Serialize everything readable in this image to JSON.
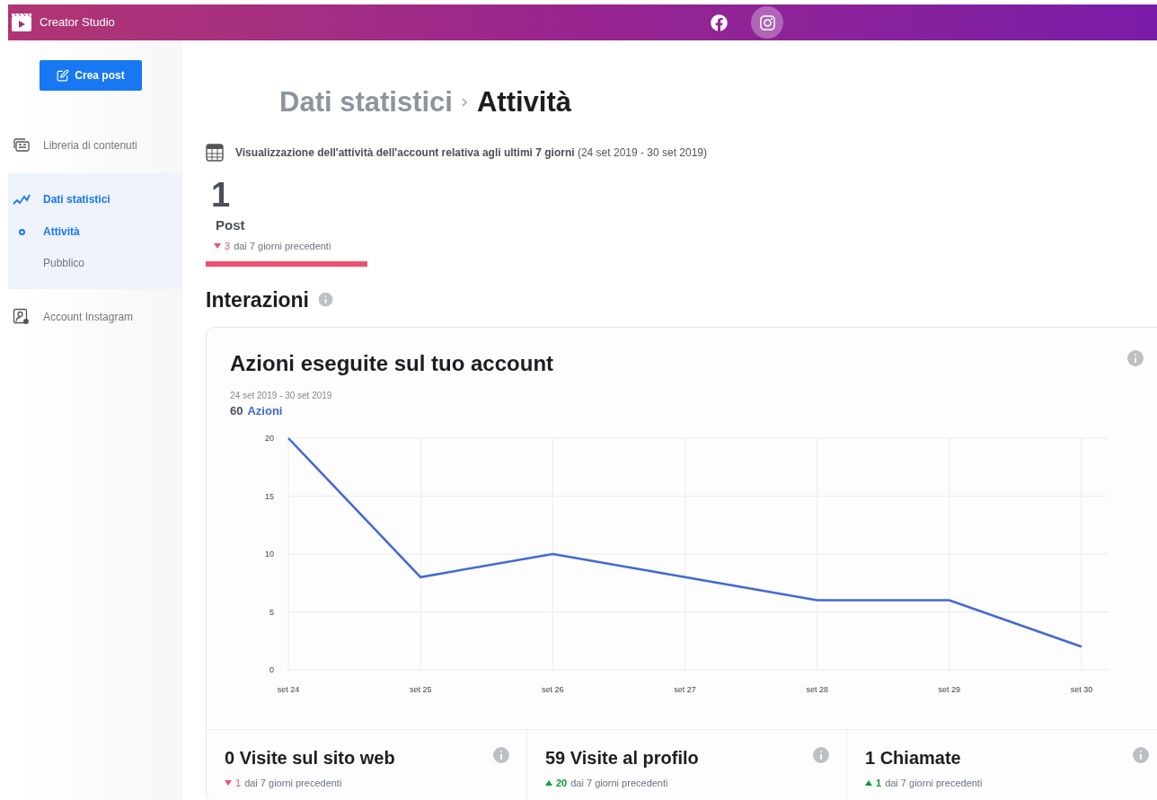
{
  "app": {
    "title": "Creator Studio"
  },
  "platforms": [
    {
      "kind": "facebook",
      "selected": false
    },
    {
      "kind": "instagram",
      "selected": true
    }
  ],
  "sidebar": {
    "create_button": "Crea post",
    "items": [
      {
        "label": "Libreria di contenuti",
        "kind": "library",
        "selected": false
      },
      {
        "label": "Dati statistici",
        "kind": "insights",
        "selected": true,
        "expanded": true,
        "children": [
          {
            "label": "Attività",
            "selected": true
          },
          {
            "label": "Pubblico",
            "selected": false
          }
        ]
      },
      {
        "label": "Account Instagram",
        "kind": "account",
        "selected": false
      }
    ]
  },
  "breadcrumb": [
    "Dati statistici",
    "Attività"
  ],
  "summary": {
    "text": "Visualizzazione dell'attività dell'account relativa agli ultimi 7 giorni",
    "range": "(24 set 2019 - 30 set 2019)"
  },
  "posts": {
    "value": "1",
    "label": "Post",
    "kind": "down",
    "delta": "3",
    "comparison": "dai 7 giorni precedenti",
    "selected": true
  },
  "section_title": "Interazioni",
  "card": {
    "title": "Azioni eseguite sul tuo account",
    "range": "24 set 2019 - 30 set 2019",
    "total": "60",
    "chart_data": {
      "type": "line",
      "categories": [
        "set 24",
        "set 25",
        "set 26",
        "set 27",
        "set 28",
        "set 29",
        "set 30"
      ],
      "series": [
        {
          "name": "Azioni",
          "color": "#4267d6",
          "values": [
            20,
            8,
            10,
            8,
            6,
            6,
            2
          ]
        }
      ],
      "grid": true,
      "ylim": [
        0,
        20
      ],
      "yticks": [
        0,
        5,
        10,
        15,
        20
      ]
    },
    "metrics": [
      {
        "title": "0 Visite sul sito web",
        "kind": "down",
        "delta": "1",
        "comparison": "dai 7 giorni precedenti"
      },
      {
        "title": "59 Visite al profilo",
        "kind": "up",
        "delta": "20",
        "comparison": "dai 7 giorni precedenti"
      },
      {
        "title": "1 Chiamate",
        "kind": "up",
        "delta": "1",
        "comparison": "dai 7 giorni precedenti"
      }
    ]
  }
}
